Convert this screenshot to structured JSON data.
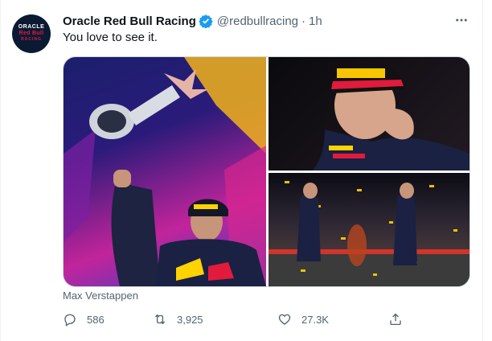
{
  "tweet": {
    "author_name": "Oracle Red Bull Racing",
    "handle": "@redbullracing",
    "separator": "·",
    "time": "1h",
    "text": "You love to see it.",
    "more_icon": "more-horizontal-icon",
    "avatar": {
      "line1": "ORACLE",
      "line2": "Red Bull",
      "line3": "RACING"
    },
    "media_tag": "Max Verstappen",
    "images": [
      {
        "description_icon": "trophy-celebration-photo"
      },
      {
        "description_icon": "driver-portrait-photo"
      },
      {
        "description_icon": "podium-champagne-photo"
      }
    ],
    "actions": {
      "reply_count": "586",
      "retweet_count": "3,925",
      "like_count": "27.3K",
      "share_label": ""
    },
    "colors": {
      "verified": "#1d9bf0",
      "muted": "#536471",
      "text": "#0f1419",
      "border": "#cfd9de"
    }
  }
}
